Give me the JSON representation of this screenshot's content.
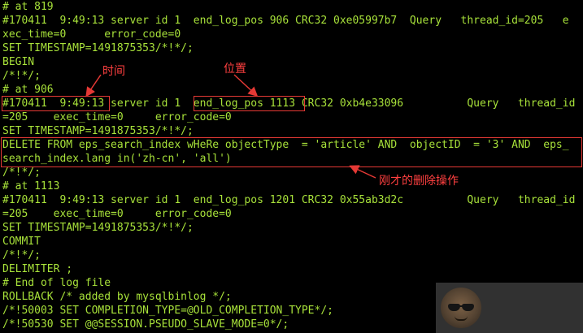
{
  "terminal": {
    "lines": [
      "# at 819",
      "#170411  9:49:13 server id 1  end_log_pos 906 CRC32 0xe05997b7  Query   thread_id=205   e",
      "xec_time=0      error_code=0",
      "SET TIMESTAMP=1491875353/*!*/;",
      "BEGIN",
      "/*!*/;",
      "# at 906",
      "#170411  9:49:13 server id 1  end_log_pos 1113 CRC32 0xb4e33096          Query   thread_id",
      "=205    exec_time=0     error_code=0",
      "SET TIMESTAMP=1491875353/*!*/;",
      "DELETE FROM eps_search_index wHeRe objectType  = 'article' AND  objectID  = '3' AND  eps_",
      "search_index.lang in('zh-cn', 'all')",
      "/*!*/;",
      "# at 1113",
      "#170411  9:49:13 server id 1  end_log_pos 1201 CRC32 0x55ab3d2c          Query   thread_id",
      "=205    exec_time=0     error_code=0",
      "SET TIMESTAMP=1491875353/*!*/;",
      "COMMIT",
      "/*!*/;",
      "DELIMITER ;",
      "# End of log file",
      "ROLLBACK /* added by mysqlbinlog */;",
      "/*!50003 SET COMPLETION_TYPE=@OLD_COMPLETION_TYPE*/;",
      "/*!50530 SET @@SESSION.PSEUDO_SLAVE_MODE=0*/;"
    ]
  },
  "annotations": {
    "time_label": "时间",
    "position_label": "位置",
    "delete_label": "刚才的删除操作"
  },
  "colors": {
    "background": "#000000",
    "terminal_text": "#a8e23a",
    "annotation": "#e53935"
  },
  "icons": {
    "avatar": "sunglasses-avatar-icon"
  }
}
